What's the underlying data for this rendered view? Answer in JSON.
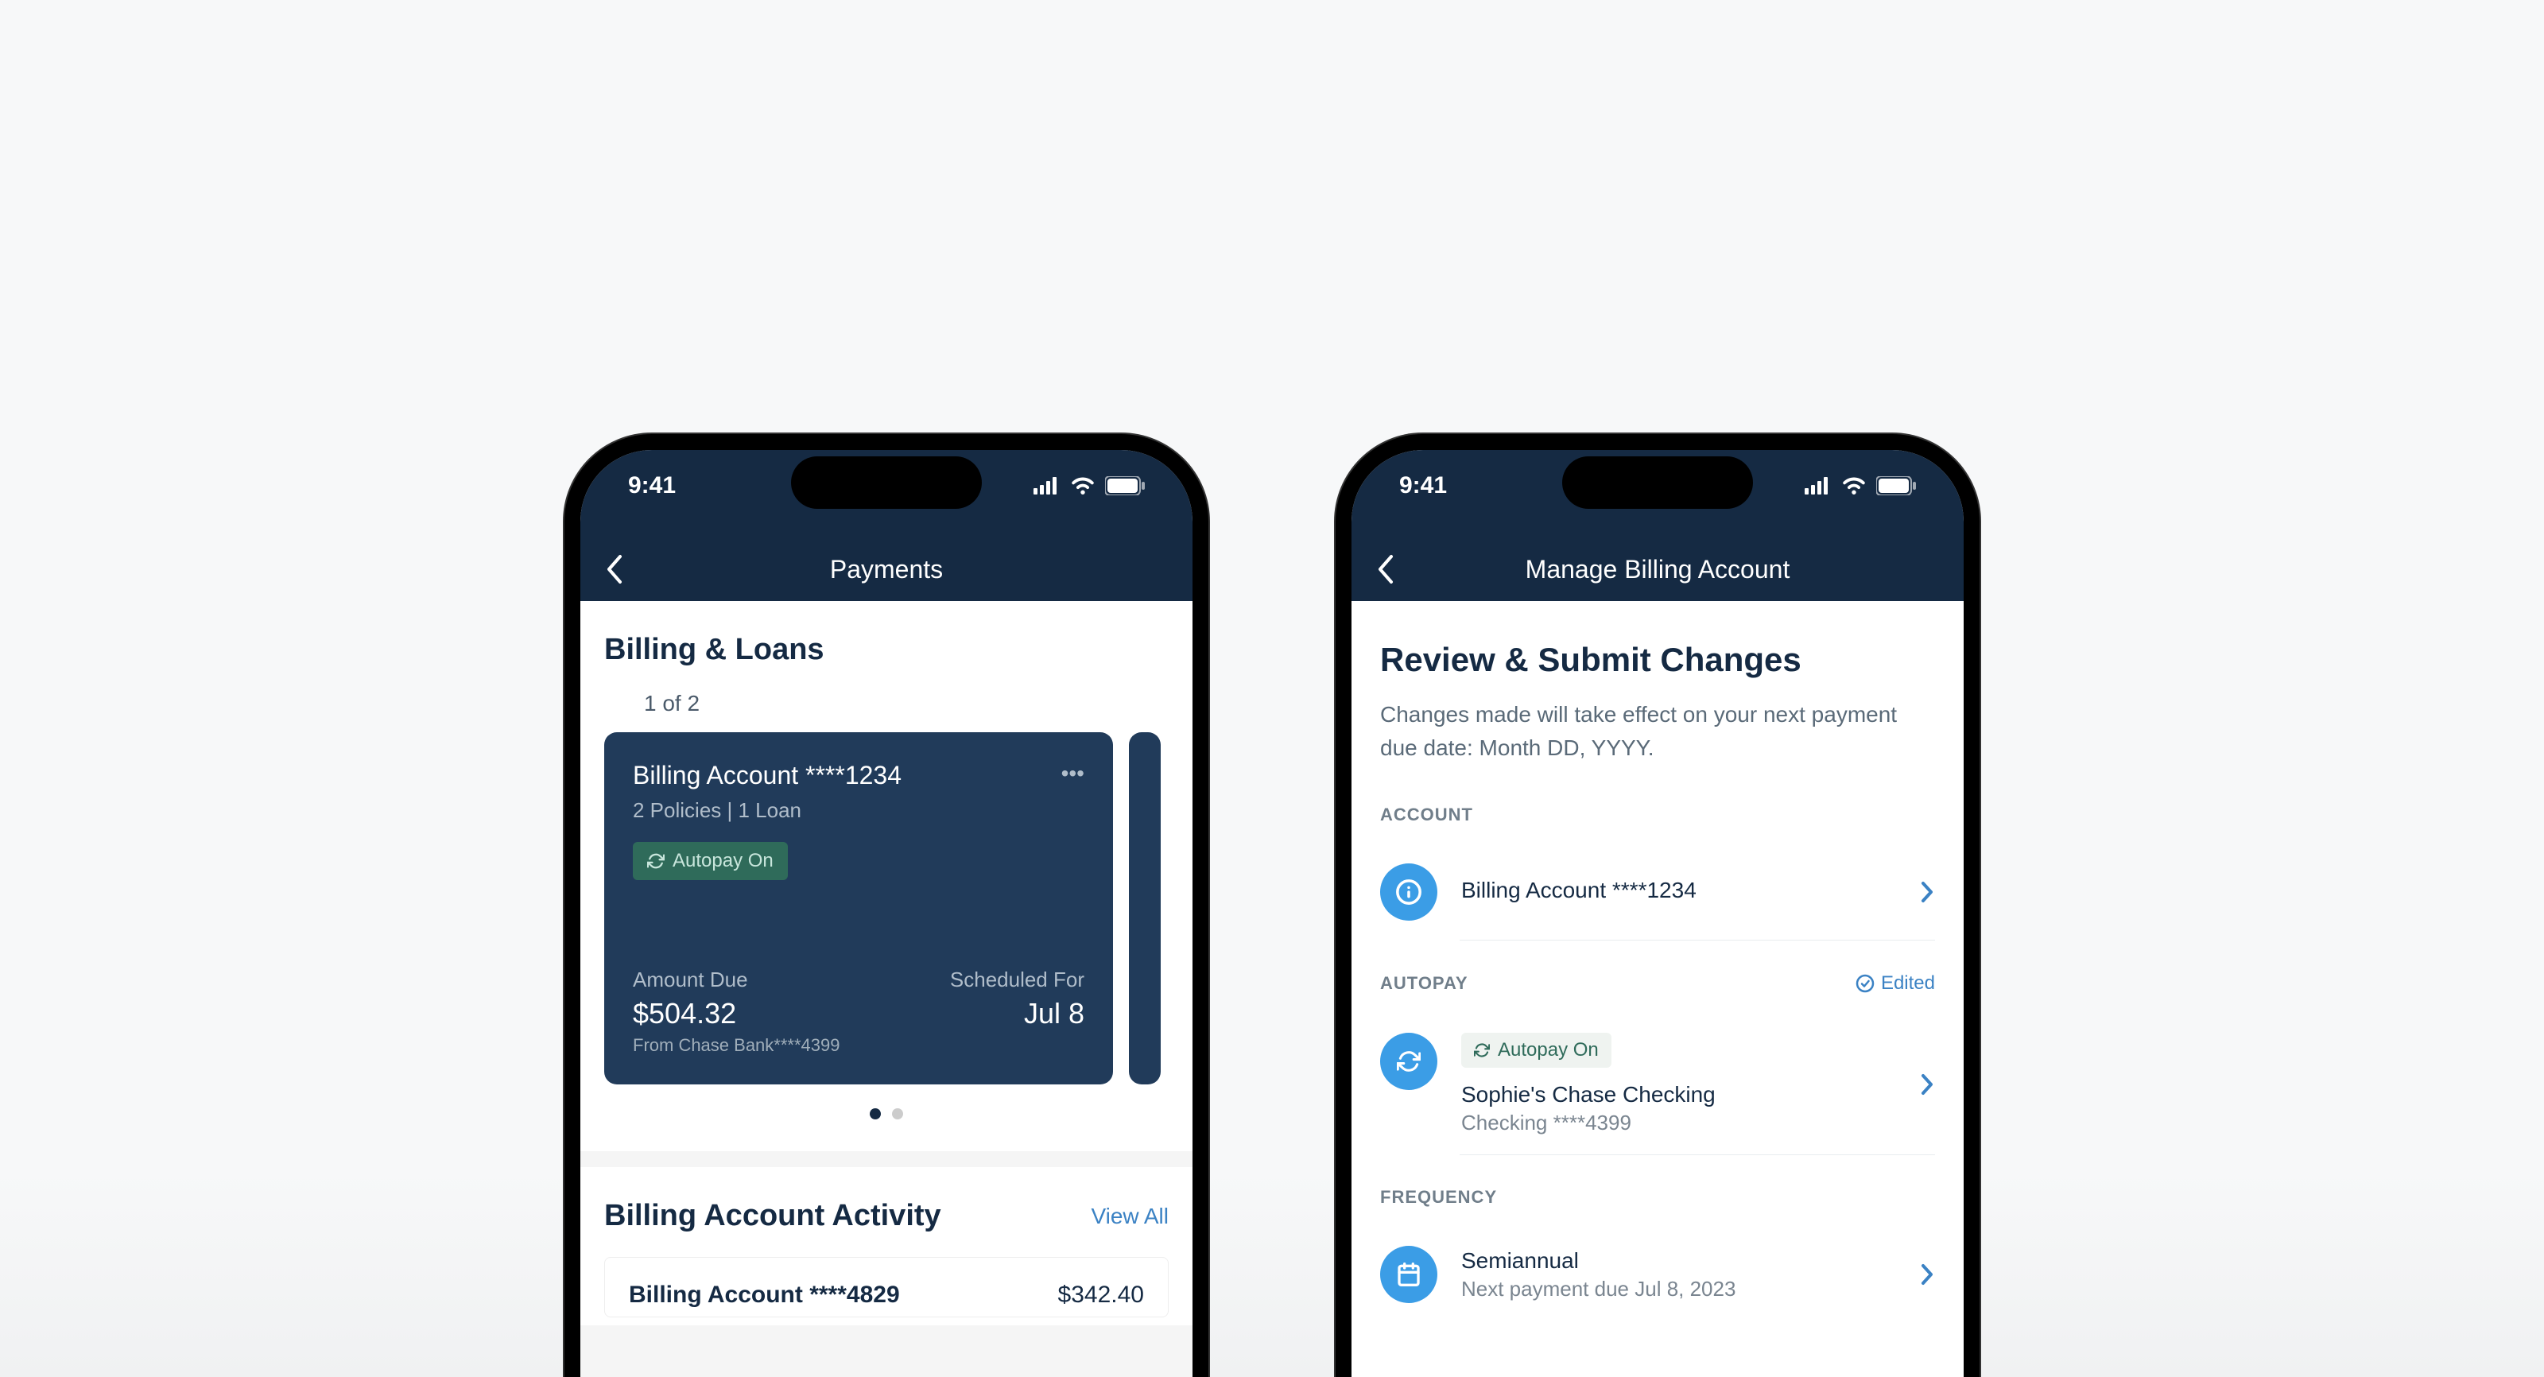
{
  "status": {
    "time": "9:41"
  },
  "phone1": {
    "nav_title": "Payments",
    "section_title": "Billing & Loans",
    "pager_info": "1 of 2",
    "card": {
      "title": "Billing Account ****1234",
      "subtitle": "2 Policies | 1 Loan",
      "autopay_label": "Autopay On",
      "amount_due_label": "Amount Due",
      "amount_due_value": "$504.32",
      "source_note": "From Chase Bank****4399",
      "scheduled_label": "Scheduled For",
      "scheduled_value": "Jul 8"
    },
    "activity": {
      "title": "Billing Account Activity",
      "view_all": "View All",
      "item_name": "Billing Account ****4829",
      "item_amount": "$342.40"
    }
  },
  "phone2": {
    "nav_title": "Manage Billing Account",
    "review_title": "Review & Submit Changes",
    "help_text": "Changes made will take effect on your next payment due date: Month DD, YYYY.",
    "account": {
      "header": "ACCOUNT",
      "name": "Billing Account ****1234"
    },
    "autopay": {
      "header": "AUTOPAY",
      "edited_label": "Edited",
      "badge_label": "Autopay On",
      "name": "Sophie's Chase Checking",
      "detail": "Checking ****4399"
    },
    "frequency": {
      "header": "FREQUENCY",
      "name": "Semiannual",
      "detail": "Next payment due Jul 8, 2023"
    }
  }
}
